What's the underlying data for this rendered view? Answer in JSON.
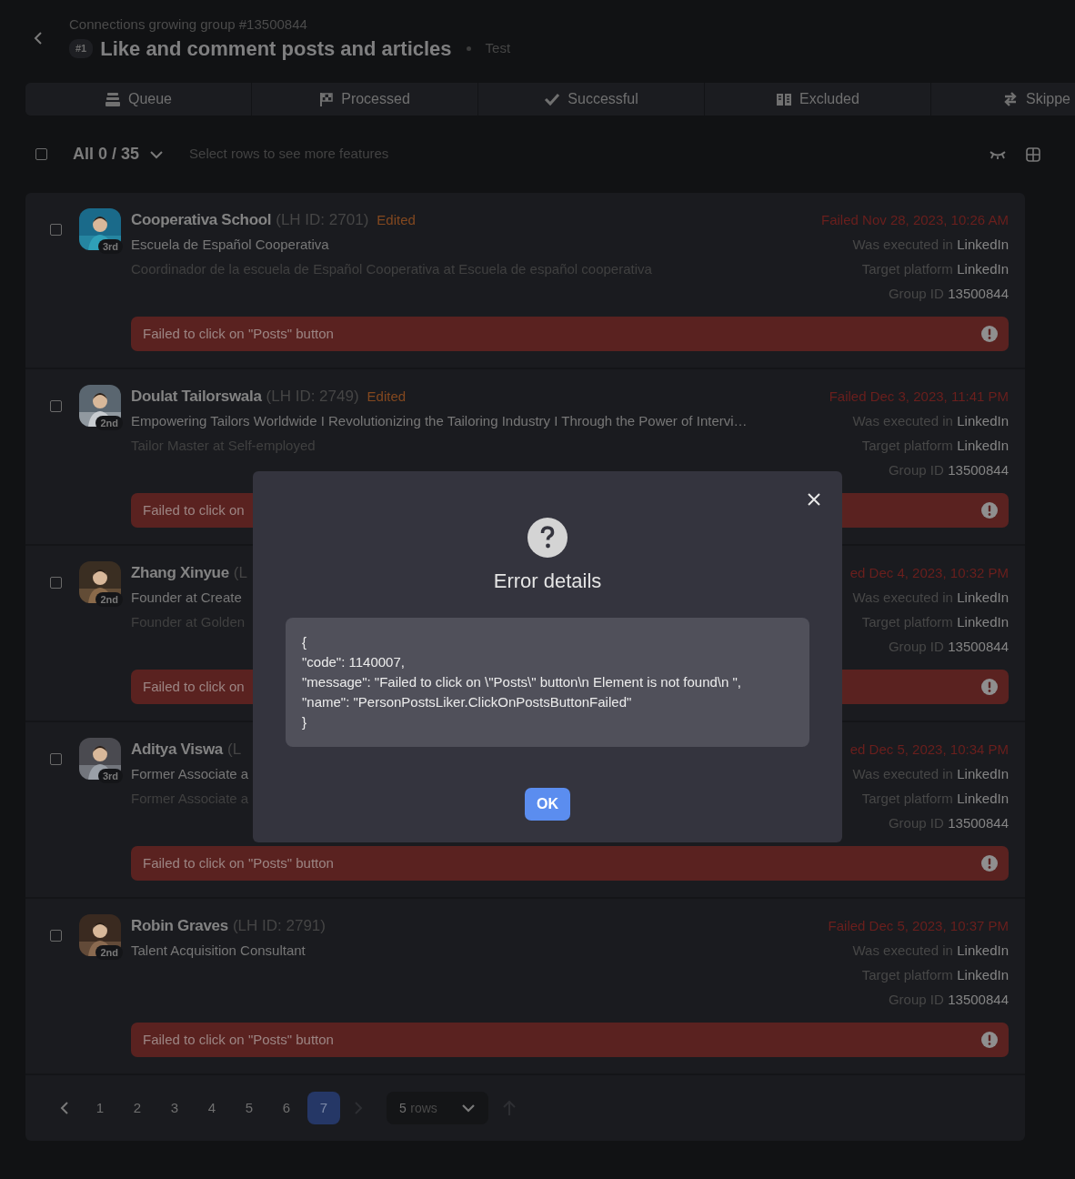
{
  "header": {
    "group": "Connections growing group #13500844",
    "badge": "#1",
    "title": "Like and comment posts and articles",
    "tag": "Test"
  },
  "tabs": [
    {
      "label": "Queue",
      "selected": false
    },
    {
      "label": "Processed",
      "selected": false
    },
    {
      "label": "Successful",
      "selected": false
    },
    {
      "label": "Excluded",
      "selected": false
    },
    {
      "label": "Skippe",
      "selected": false
    }
  ],
  "toolbar": {
    "checked": false,
    "count": "All 0 / 35",
    "hint": "Select rows to see more features"
  },
  "rows": [
    {
      "checked": false,
      "degree": "3rd",
      "name": "Cooperativa School",
      "lh_id": "(LH ID: 2701)",
      "edited": "Edited",
      "subtitle": "Escuela de Español Cooperativa",
      "headline": "Coordinador de la escuela de Español Cooperativa at Escuela de español cooperativa",
      "status": "Failed Nov 28, 2023, 10:26 AM",
      "executed_label": "Was executed in",
      "executed": "LinkedIn",
      "platform_label": "Target platform",
      "platform": "LinkedIn",
      "group_label": "Group ID",
      "group": "13500844",
      "error": "Failed to click on \"Posts\" button"
    },
    {
      "checked": false,
      "degree": "2nd",
      "name": "Doulat Tailorswala",
      "lh_id": "(LH ID: 2749)",
      "edited": "Edited",
      "subtitle": "Empowering Tailors Worldwide I Revolutionizing the Tailoring Industry I Through the Power of Intervi…",
      "headline": "Tailor Master at Self-employed",
      "status": "Failed Dec 3, 2023, 11:41 PM",
      "executed_label": "Was executed in",
      "executed": "LinkedIn",
      "platform_label": "Target platform",
      "platform": "LinkedIn",
      "group_label": "Group ID",
      "group": "13500844",
      "error": "Failed to click on"
    },
    {
      "checked": false,
      "degree": "2nd",
      "name": "Zhang Xinyue",
      "lh_id": "(L",
      "subtitle": "Founder at Create",
      "headline": "Founder at Golden",
      "status": "ed Dec 4, 2023, 10:32 PM",
      "executed_label": "Was executed in",
      "executed": "LinkedIn",
      "platform_label": "Target platform",
      "platform": "LinkedIn",
      "group_label": "Group ID",
      "group": "13500844",
      "error": "Failed to click on"
    },
    {
      "checked": false,
      "degree": "3rd",
      "name": "Aditya Viswa",
      "lh_id": "(L",
      "subtitle": "Former Associate a",
      "headline": "Former Associate a",
      "status": "ed Dec 5, 2023, 10:34 PM",
      "executed_label": "Was executed in",
      "executed": "LinkedIn",
      "platform_label": "Target platform",
      "platform": "LinkedIn",
      "group_label": "Group ID",
      "group": "13500844",
      "error": "Failed to click on \"Posts\" button"
    },
    {
      "checked": false,
      "degree": "2nd",
      "name": "Robin Graves",
      "lh_id": "(LH ID: 2791)",
      "subtitle": "Talent Acquisition Consultant",
      "status": "Failed Dec 5, 2023, 10:37 PM",
      "executed_label": "Was executed in",
      "executed": "LinkedIn",
      "platform_label": "Target platform",
      "platform": "LinkedIn",
      "group_label": "Group ID",
      "group": "13500844",
      "error": "Failed to click on \"Posts\" button"
    }
  ],
  "pagination": {
    "prev": {
      "disabled": false
    },
    "next": {
      "disabled": true
    },
    "pages": [
      {
        "label": "1",
        "selected": false
      },
      {
        "label": "2",
        "selected": false
      },
      {
        "label": "3",
        "selected": false
      },
      {
        "label": "4",
        "selected": false
      },
      {
        "label": "5",
        "selected": false
      },
      {
        "label": "6",
        "selected": false
      },
      {
        "label": "7",
        "selected": true
      }
    ],
    "rows_value": "5",
    "rows_label": "rows"
  },
  "modal": {
    "title": "Error details",
    "code_lines": [
      "{",
      "\"code\": 1140007,",
      "\"message\": \"Failed to click on \\\"Posts\\\" button\\n Element is not found\\n \",",
      "\"name\": \"PersonPostsLiker.ClickOnPostsButtonFailed\"",
      "}"
    ],
    "ok": "OK"
  }
}
